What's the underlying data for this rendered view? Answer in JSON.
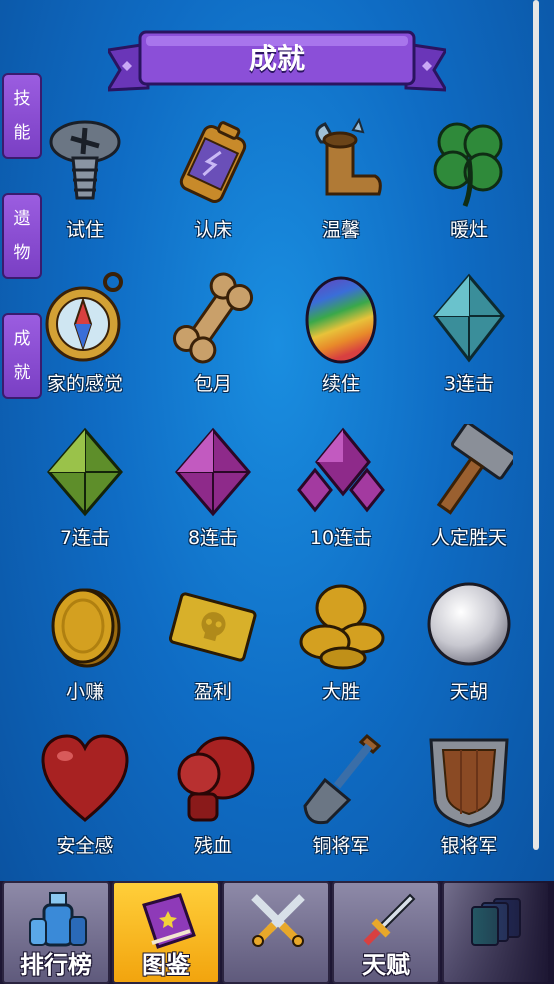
{
  "header": {
    "title": "成就"
  },
  "side_tabs": [
    {
      "char1": "技",
      "char2": "能"
    },
    {
      "char1": "遗",
      "char2": "物"
    },
    {
      "char1": "成",
      "char2": "就"
    }
  ],
  "items": [
    {
      "label": "试住",
      "icon": "screw-icon"
    },
    {
      "label": "认床",
      "icon": "battery-icon"
    },
    {
      "label": "温馨",
      "icon": "winged-boot-icon"
    },
    {
      "label": "暖灶",
      "icon": "clover-icon"
    },
    {
      "label": "家的感觉",
      "icon": "compass-icon"
    },
    {
      "label": "包月",
      "icon": "bone-icon"
    },
    {
      "label": "续住",
      "icon": "rainbow-egg-icon"
    },
    {
      "label": "3连击",
      "icon": "teal-gem-icon"
    },
    {
      "label": "7连击",
      "icon": "green-gem-icon"
    },
    {
      "label": "8连击",
      "icon": "purple-gem-icon"
    },
    {
      "label": "10连击",
      "icon": "gem-cluster-icon"
    },
    {
      "label": "人定胜天",
      "icon": "hammer-icon"
    },
    {
      "label": "小赚",
      "icon": "coin-icon"
    },
    {
      "label": "盈利",
      "icon": "skull-ticket-icon"
    },
    {
      "label": "大胜",
      "icon": "coin-pile-icon"
    },
    {
      "label": "天胡",
      "icon": "pearl-icon"
    },
    {
      "label": "安全感",
      "icon": "heart-icon"
    },
    {
      "label": "残血",
      "icon": "boxing-glove-icon"
    },
    {
      "label": "铜将军",
      "icon": "shovel-icon"
    },
    {
      "label": "银将军",
      "icon": "shield-icon"
    }
  ],
  "bottom_nav": [
    {
      "label": "排行榜",
      "icon": "potion-bottles-icon",
      "active": false
    },
    {
      "label": "图鉴",
      "icon": "book-icon",
      "active": true
    },
    {
      "label": "",
      "icon": "crossed-swords-icon",
      "active": false
    },
    {
      "label": "天赋",
      "icon": "sword-icon",
      "active": false
    },
    {
      "label": "",
      "icon": "cards-icon",
      "active": false
    }
  ],
  "colors": {
    "background": "#0f6cc4",
    "banner": "#7a3fc4",
    "nav_active": "#f2a40e",
    "tab": "#9b5de0"
  }
}
